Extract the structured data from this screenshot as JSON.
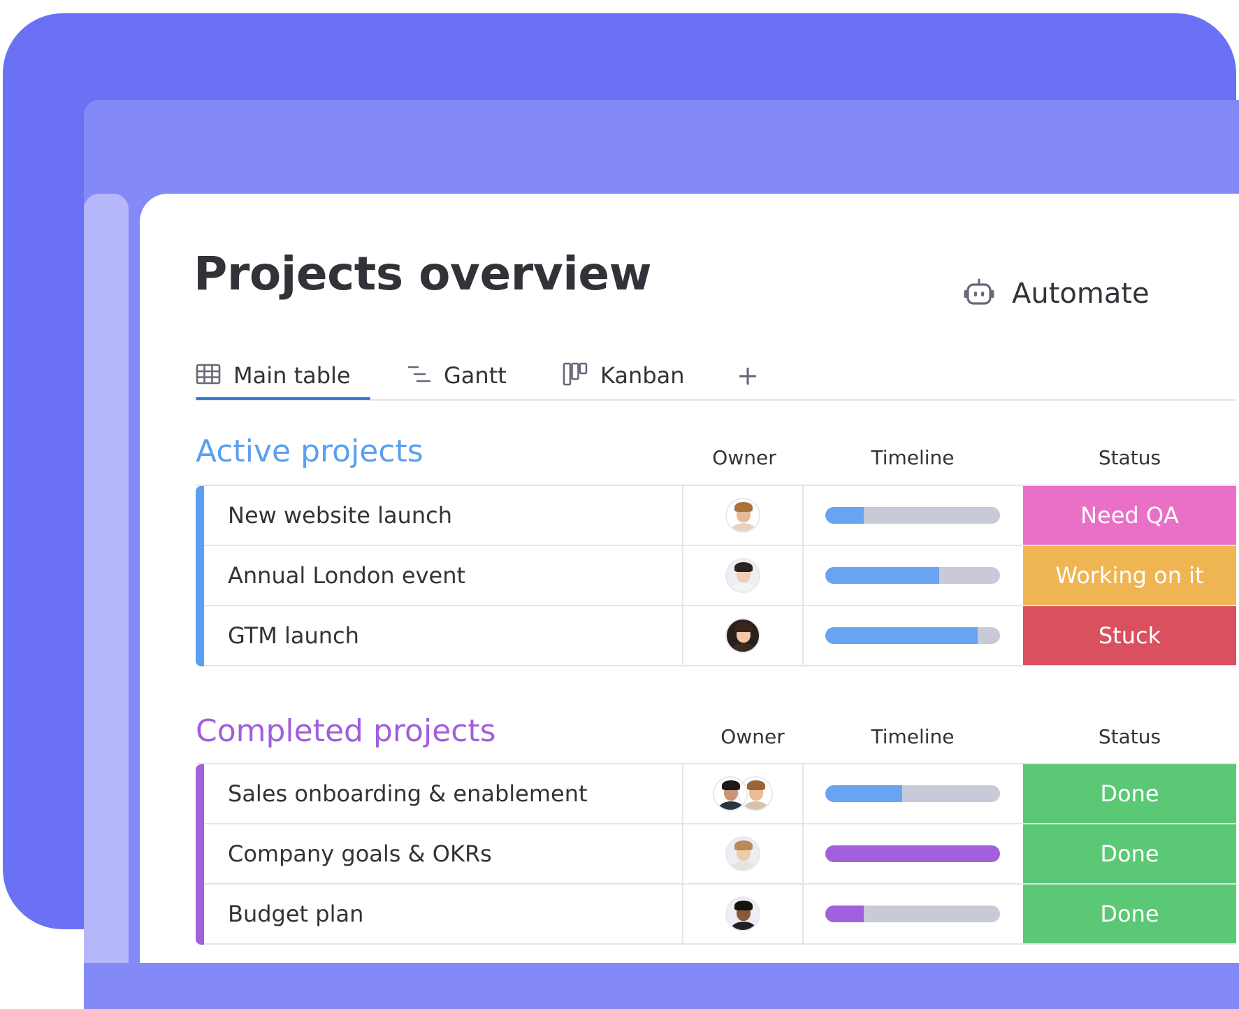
{
  "page": {
    "title": "Projects overview",
    "automate_label": "Automate"
  },
  "tabs": [
    {
      "label": "Main table",
      "icon": "table-icon",
      "active": true
    },
    {
      "label": "Gantt",
      "icon": "gantt-icon",
      "active": false
    },
    {
      "label": "Kanban",
      "icon": "kanban-icon",
      "active": false
    }
  ],
  "tab_add_label": "+",
  "colors": {
    "outer_bg": "#6b71f5",
    "tab_underline": "#3b7ad9",
    "active_group": "#5b9ff0",
    "completed_group": "#a25ddc",
    "timeline_blue": "#6aa3f2",
    "timeline_purple": "#a160dc",
    "timeline_track": "#c8cbd7",
    "status_need_qa": "#ea6fc7",
    "status_working": "#f0b553",
    "status_stuck": "#d9505f",
    "status_done": "#5bc876"
  },
  "groups": {
    "active": {
      "title": "Active projects",
      "columns": {
        "owner": "Owner",
        "timeline": "Timeline",
        "status": "Status"
      },
      "rows": [
        {
          "name": "New website launch",
          "owner": "woman-curly-hair-avatar",
          "timeline_progress": 0.22,
          "status": "Need QA"
        },
        {
          "name": "Annual London event",
          "owner": "man-beard-avatar",
          "timeline_progress": 0.65,
          "status": "Working on it"
        },
        {
          "name": "GTM launch",
          "owner": "woman-dark-hair-avatar",
          "timeline_progress": 0.87,
          "status": "Stuck"
        }
      ]
    },
    "completed": {
      "title": "Completed projects",
      "columns": {
        "owner": "Owner",
        "timeline": "Timeline",
        "status": "Status"
      },
      "rows": [
        {
          "name": "Sales onboarding & enablement",
          "owner": "two-person-avatar",
          "timeline_progress": 0.44,
          "status": "Done"
        },
        {
          "name": "Company goals & OKRs",
          "owner": "woman-blonde-avatar",
          "timeline_progress": 1.0,
          "status": "Done"
        },
        {
          "name": "Budget plan",
          "owner": "man-dark-avatar",
          "timeline_progress": 0.22,
          "status": "Done"
        }
      ]
    }
  }
}
